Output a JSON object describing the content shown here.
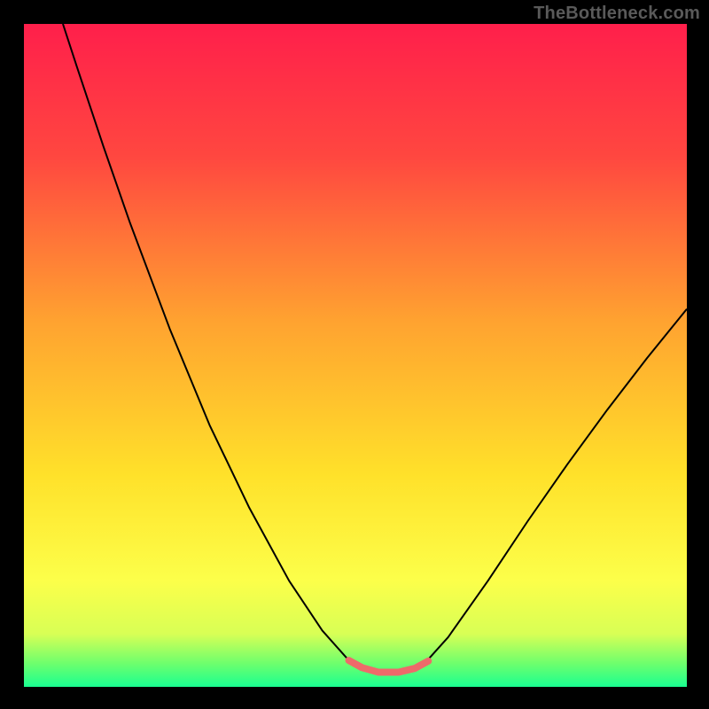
{
  "watermark": {
    "text": "TheBottleneck.com"
  },
  "chart_data": {
    "type": "line",
    "title": "",
    "xlabel": "",
    "ylabel": "",
    "xlim": [
      0,
      100
    ],
    "ylim": [
      0,
      100
    ],
    "grid": false,
    "legend": false,
    "background_gradient": {
      "stops": [
        {
          "pos": 0.0,
          "color": "#ff1f4b"
        },
        {
          "pos": 0.2,
          "color": "#ff4740"
        },
        {
          "pos": 0.45,
          "color": "#ffa330"
        },
        {
          "pos": 0.68,
          "color": "#ffe12a"
        },
        {
          "pos": 0.84,
          "color": "#fcff4a"
        },
        {
          "pos": 0.92,
          "color": "#d8ff55"
        },
        {
          "pos": 0.965,
          "color": "#6dff6d"
        },
        {
          "pos": 1.0,
          "color": "#1aff91"
        }
      ]
    },
    "series": [
      {
        "name": "curve",
        "stroke": "#000000",
        "stroke_width": 2,
        "points": [
          {
            "x": 5.88,
            "y": 100.0
          },
          {
            "x": 8.0,
            "y": 93.5
          },
          {
            "x": 12.0,
            "y": 81.5
          },
          {
            "x": 16.0,
            "y": 70.0
          },
          {
            "x": 22.0,
            "y": 54.0
          },
          {
            "x": 28.0,
            "y": 39.5
          },
          {
            "x": 34.0,
            "y": 27.0
          },
          {
            "x": 40.0,
            "y": 16.0
          },
          {
            "x": 45.0,
            "y": 8.5
          },
          {
            "x": 49.0,
            "y": 4.0
          },
          {
            "x": 51.5,
            "y": 2.7
          },
          {
            "x": 53.5,
            "y": 2.2
          },
          {
            "x": 56.5,
            "y": 2.2
          },
          {
            "x": 58.5,
            "y": 2.6
          },
          {
            "x": 60.5,
            "y": 3.6
          },
          {
            "x": 64.0,
            "y": 7.5
          },
          {
            "x": 70.0,
            "y": 16.0
          },
          {
            "x": 76.0,
            "y": 25.0
          },
          {
            "x": 82.0,
            "y": 33.6
          },
          {
            "x": 88.0,
            "y": 41.8
          },
          {
            "x": 94.0,
            "y": 49.6
          },
          {
            "x": 100.0,
            "y": 57.0
          }
        ]
      },
      {
        "name": "valley-marker",
        "stroke": "#ee6a6a",
        "stroke_width": 8,
        "stroke_linecap": "round",
        "points": [
          {
            "x": 49.0,
            "y": 4.0
          },
          {
            "x": 51.0,
            "y": 2.9
          },
          {
            "x": 53.5,
            "y": 2.2
          },
          {
            "x": 56.5,
            "y": 2.2
          },
          {
            "x": 59.0,
            "y": 2.8
          },
          {
            "x": 61.0,
            "y": 3.9
          }
        ]
      }
    ]
  }
}
